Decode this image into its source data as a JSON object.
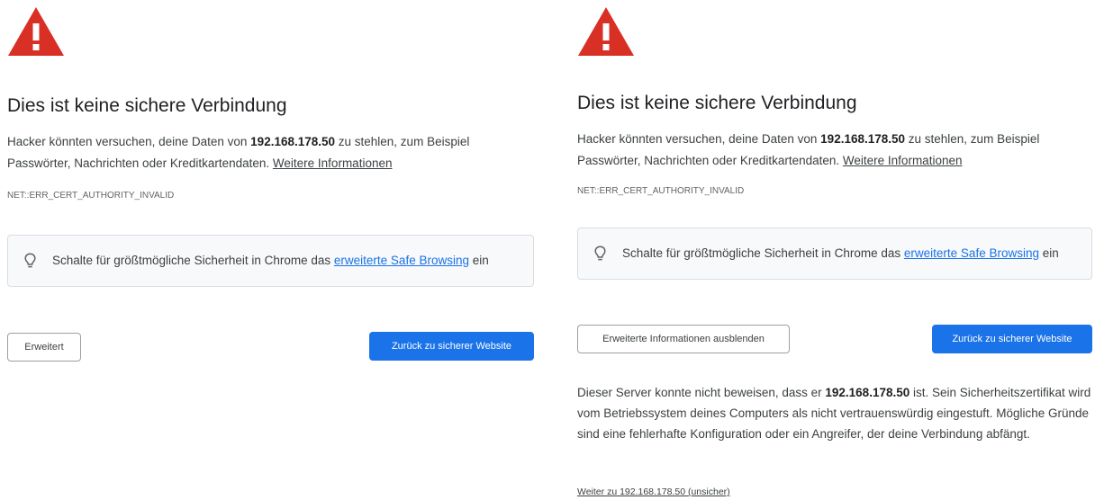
{
  "colors": {
    "warning_red": "#d93025",
    "primary_blue": "#1a73e8",
    "text": "#202124",
    "secondary_text": "#3c4043"
  },
  "left": {
    "icon": "warning-triangle-icon",
    "heading": "Dies ist keine sichere Verbindung",
    "message": {
      "pre": "Hacker könnten versuchen, deine Daten von ",
      "host": "192.168.178.50",
      "post": " zu stehlen, zum Beispiel Passwörter, Nachrichten oder Kreditkartendaten. ",
      "more_info_link": "Weitere Informationen"
    },
    "error_code": "NET::ERR_CERT_AUTHORITY_INVALID",
    "safe_browsing": {
      "icon": "lightbulb-icon",
      "text_pre": "Schalte für größtmögliche Sicherheit in Chrome das ",
      "link": "erweiterte Safe Browsing",
      "text_post": " ein"
    },
    "advanced_button": "Erweitert",
    "back_button": "Zurück zu sicherer Website"
  },
  "right": {
    "icon": "warning-triangle-icon",
    "heading": "Dies ist keine sichere Verbindung",
    "message": {
      "pre": "Hacker könnten versuchen, deine Daten von ",
      "host": "192.168.178.50",
      "post": " zu stehlen, zum Beispiel Passwörter, Nachrichten oder Kreditkartendaten. ",
      "more_info_link": "Weitere Informationen"
    },
    "error_code": "NET::ERR_CERT_AUTHORITY_INVALID",
    "safe_browsing": {
      "icon": "lightbulb-icon",
      "text_pre": "Schalte für größtmögliche Sicherheit in Chrome das ",
      "link": "erweiterte Safe Browsing",
      "text_post": " ein"
    },
    "hide_details_button": "Erweiterte Informationen ausblenden",
    "back_button": "Zurück zu sicherer Website",
    "details": {
      "pre": "Dieser Server konnte nicht beweisen, dass er ",
      "host": "192.168.178.50",
      "post": " ist. Sein Sicherheitszertifikat wird vom Betriebssystem deines Computers als nicht vertrauenswürdig eingestuft. Mögliche Gründe sind eine fehlerhafte Konfiguration oder ein Angreifer, der deine Verbindung abfängt."
    },
    "proceed_link": "Weiter zu 192.168.178.50 (unsicher)"
  }
}
